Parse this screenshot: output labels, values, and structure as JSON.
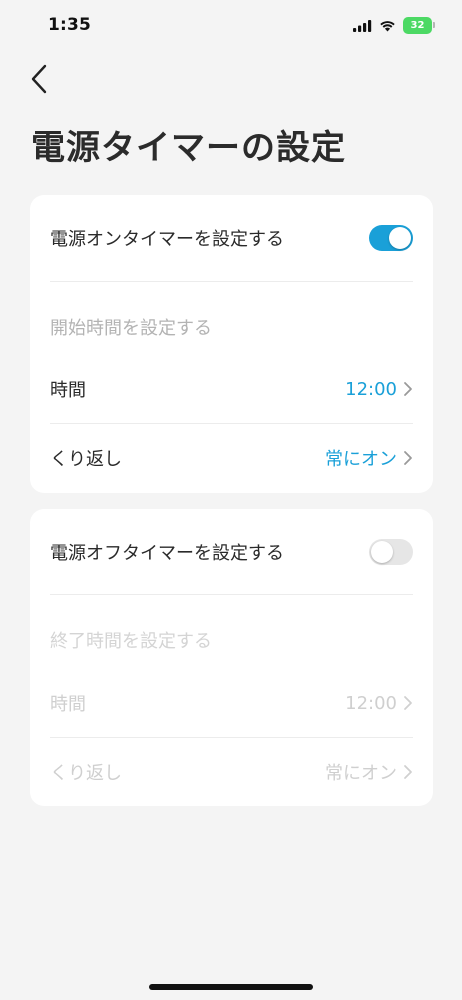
{
  "status_bar": {
    "time": "1:35",
    "battery": "32"
  },
  "header": {
    "title": "電源タイマーの設定"
  },
  "on_timer": {
    "toggle_label": "電源オンタイマーを設定する",
    "enabled": true,
    "section_label": "開始時間を設定する",
    "time_label": "時間",
    "time_value": "12:00",
    "repeat_label": "くり返し",
    "repeat_value": "常にオン"
  },
  "off_timer": {
    "toggle_label": "電源オフタイマーを設定する",
    "enabled": false,
    "section_label": "終了時間を設定する",
    "time_label": "時間",
    "time_value": "12:00",
    "repeat_label": "くり返し",
    "repeat_value": "常にオン"
  },
  "colors": {
    "accent": "#1aa0d8",
    "background": "#f4f4f4",
    "card": "#ffffff",
    "disabled_text": "#cfcfcf",
    "battery": "#4cd964"
  },
  "icons": [
    "cellular-signal-icon",
    "wifi-icon",
    "battery-icon",
    "back-chevron-icon",
    "chevron-right-icon"
  ]
}
